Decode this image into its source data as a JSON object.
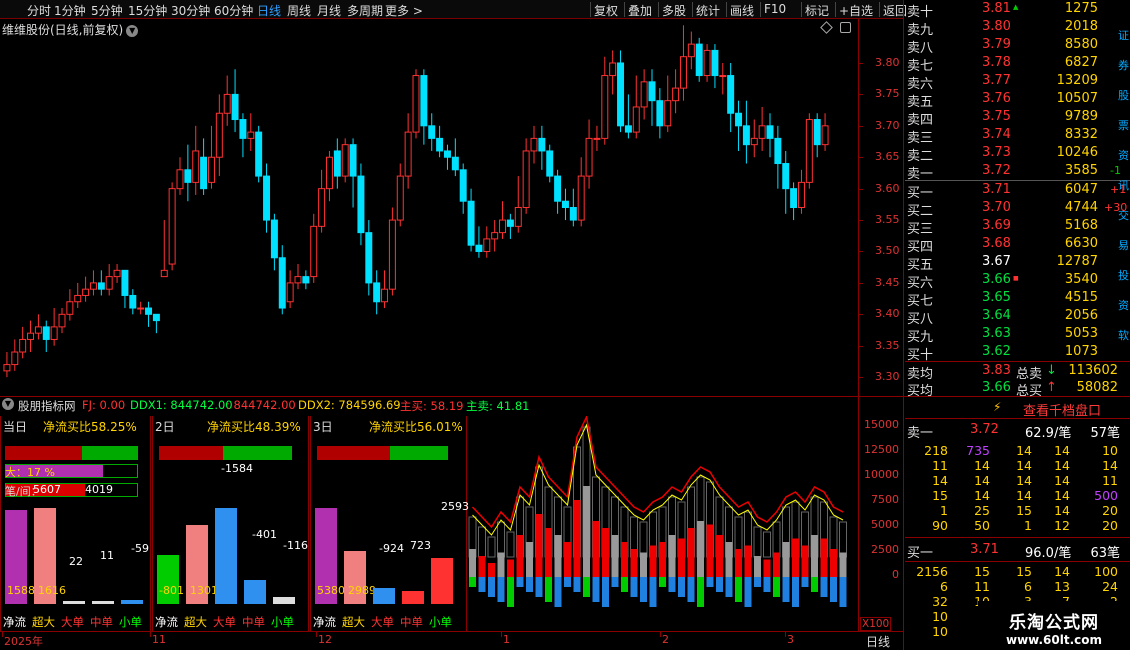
{
  "toolbar": {
    "periods": [
      "分时",
      "1分钟",
      "5分钟",
      "15分钟",
      "30分钟",
      "60分钟",
      "日线",
      "周线",
      "月线",
      "多周期",
      "更多 >"
    ],
    "active": "日线",
    "right": [
      "复权",
      "叠加",
      "多股",
      "统计",
      "画线",
      "F10",
      "标记",
      "+自选",
      "返回"
    ]
  },
  "chart": {
    "title": "维维股份(日线,前复权)",
    "price_ticks": [
      "3.80",
      "3.75",
      "3.70",
      "3.65",
      "3.60",
      "3.55",
      "3.50",
      "3.45",
      "3.40",
      "3.35",
      "3.30"
    ],
    "colors": {
      "up": "#ff3232",
      "down": "#00e0ff",
      "bg": "#000000"
    }
  },
  "chart_data": {
    "type": "candlestick",
    "ylim": [
      3.27,
      3.87
    ],
    "candles": [
      [
        3.31,
        3.32,
        3.3,
        3.34
      ],
      [
        3.32,
        3.34,
        3.31,
        3.36
      ],
      [
        3.34,
        3.36,
        3.33,
        3.38
      ],
      [
        3.36,
        3.37,
        3.34,
        3.39
      ],
      [
        3.37,
        3.38,
        3.36,
        3.4
      ],
      [
        3.38,
        3.36,
        3.34,
        3.39
      ],
      [
        3.36,
        3.38,
        3.35,
        3.41
      ],
      [
        3.38,
        3.4,
        3.37,
        3.41
      ],
      [
        3.4,
        3.42,
        3.39,
        3.44
      ],
      [
        3.42,
        3.43,
        3.41,
        3.45
      ],
      [
        3.43,
        3.44,
        3.42,
        3.46
      ],
      [
        3.44,
        3.45,
        3.43,
        3.47
      ],
      [
        3.45,
        3.44,
        3.43,
        3.47
      ],
      [
        3.44,
        3.46,
        3.43,
        3.48
      ],
      [
        3.46,
        3.47,
        3.45,
        3.48
      ],
      [
        3.47,
        3.43,
        3.41,
        3.47
      ],
      [
        3.43,
        3.41,
        3.4,
        3.44
      ],
      [
        3.41,
        3.41,
        3.4,
        3.42
      ],
      [
        3.41,
        3.4,
        3.38,
        3.42
      ],
      [
        3.4,
        3.39,
        3.37,
        3.4
      ],
      [
        3.46,
        3.47,
        3.46,
        3.55
      ],
      [
        3.48,
        3.6,
        3.47,
        3.61
      ],
      [
        3.6,
        3.63,
        3.59,
        3.65
      ],
      [
        3.63,
        3.61,
        3.58,
        3.67
      ],
      [
        3.61,
        3.66,
        3.59,
        3.7
      ],
      [
        3.65,
        3.6,
        3.59,
        3.68
      ],
      [
        3.61,
        3.65,
        3.6,
        3.7
      ],
      [
        3.65,
        3.72,
        3.62,
        3.75
      ],
      [
        3.72,
        3.75,
        3.7,
        3.78
      ],
      [
        3.75,
        3.71,
        3.69,
        3.79
      ],
      [
        3.71,
        3.68,
        3.65,
        3.72
      ],
      [
        3.68,
        3.69,
        3.66,
        3.72
      ],
      [
        3.69,
        3.62,
        3.61,
        3.7
      ],
      [
        3.62,
        3.55,
        3.53,
        3.64
      ],
      [
        3.55,
        3.49,
        3.47,
        3.56
      ],
      [
        3.49,
        3.41,
        3.4,
        3.51
      ],
      [
        3.42,
        3.45,
        3.41,
        3.47
      ],
      [
        3.45,
        3.46,
        3.44,
        3.48
      ],
      [
        3.46,
        3.45,
        3.44,
        3.47
      ],
      [
        3.46,
        3.54,
        3.45,
        3.56
      ],
      [
        3.54,
        3.6,
        3.53,
        3.63
      ],
      [
        3.6,
        3.65,
        3.58,
        3.66
      ],
      [
        3.66,
        3.62,
        3.6,
        3.68
      ],
      [
        3.62,
        3.67,
        3.61,
        3.68
      ],
      [
        3.67,
        3.62,
        3.57,
        3.68
      ],
      [
        3.62,
        3.53,
        3.51,
        3.64
      ],
      [
        3.53,
        3.45,
        3.43,
        3.55
      ],
      [
        3.45,
        3.42,
        3.4,
        3.47
      ],
      [
        3.42,
        3.44,
        3.41,
        3.47
      ],
      [
        3.44,
        3.55,
        3.43,
        3.57
      ],
      [
        3.55,
        3.62,
        3.54,
        3.64
      ],
      [
        3.62,
        3.69,
        3.6,
        3.72
      ],
      [
        3.69,
        3.78,
        3.68,
        3.79
      ],
      [
        3.78,
        3.7,
        3.67,
        3.79
      ],
      [
        3.7,
        3.68,
        3.66,
        3.72
      ],
      [
        3.68,
        3.66,
        3.65,
        3.7
      ],
      [
        3.66,
        3.65,
        3.63,
        3.67
      ],
      [
        3.65,
        3.63,
        3.62,
        3.68
      ],
      [
        3.63,
        3.58,
        3.56,
        3.64
      ],
      [
        3.58,
        3.51,
        3.5,
        3.6
      ],
      [
        3.51,
        3.5,
        3.49,
        3.54
      ],
      [
        3.5,
        3.52,
        3.49,
        3.54
      ],
      [
        3.52,
        3.53,
        3.5,
        3.55
      ],
      [
        3.53,
        3.55,
        3.52,
        3.58
      ],
      [
        3.55,
        3.54,
        3.52,
        3.56
      ],
      [
        3.54,
        3.57,
        3.53,
        3.62
      ],
      [
        3.57,
        3.66,
        3.56,
        3.68
      ],
      [
        3.66,
        3.68,
        3.64,
        3.7
      ],
      [
        3.68,
        3.66,
        3.63,
        3.7
      ],
      [
        3.66,
        3.62,
        3.61,
        3.67
      ],
      [
        3.62,
        3.58,
        3.56,
        3.63
      ],
      [
        3.58,
        3.57,
        3.55,
        3.6
      ],
      [
        3.57,
        3.55,
        3.54,
        3.6
      ],
      [
        3.55,
        3.62,
        3.54,
        3.65
      ],
      [
        3.62,
        3.68,
        3.6,
        3.71
      ],
      [
        3.68,
        3.68,
        3.66,
        3.7
      ],
      [
        3.68,
        3.78,
        3.67,
        3.81
      ],
      [
        3.78,
        3.8,
        3.75,
        3.82
      ],
      [
        3.8,
        3.7,
        3.69,
        3.82
      ],
      [
        3.7,
        3.69,
        3.68,
        3.75
      ],
      [
        3.69,
        3.73,
        3.68,
        3.78
      ],
      [
        3.73,
        3.77,
        3.71,
        3.79
      ],
      [
        3.77,
        3.74,
        3.7,
        3.79
      ],
      [
        3.74,
        3.7,
        3.68,
        3.76
      ],
      [
        3.7,
        3.74,
        3.69,
        3.78
      ],
      [
        3.74,
        3.76,
        3.72,
        3.79
      ],
      [
        3.76,
        3.81,
        3.74,
        3.86
      ],
      [
        3.81,
        3.83,
        3.79,
        3.85
      ],
      [
        3.83,
        3.78,
        3.77,
        3.84
      ],
      [
        3.78,
        3.82,
        3.77,
        3.83
      ],
      [
        3.82,
        3.78,
        3.76,
        3.83
      ],
      [
        3.78,
        3.78,
        3.75,
        3.8
      ],
      [
        3.78,
        3.72,
        3.69,
        3.8
      ],
      [
        3.72,
        3.7,
        3.66,
        3.74
      ],
      [
        3.7,
        3.67,
        3.64,
        3.74
      ],
      [
        3.67,
        3.68,
        3.65,
        3.71
      ],
      [
        3.68,
        3.7,
        3.66,
        3.73
      ],
      [
        3.7,
        3.68,
        3.65,
        3.72
      ],
      [
        3.68,
        3.64,
        3.6,
        3.7
      ],
      [
        3.64,
        3.6,
        3.56,
        3.66
      ],
      [
        3.6,
        3.57,
        3.55,
        3.61
      ],
      [
        3.57,
        3.61,
        3.56,
        3.63
      ],
      [
        3.61,
        3.71,
        3.6,
        3.72
      ],
      [
        3.71,
        3.67,
        3.65,
        3.72
      ],
      [
        3.67,
        3.7,
        3.66,
        3.72
      ]
    ]
  },
  "indicator_bar": {
    "name": "股朋指标网",
    "items": [
      {
        "t": "FJ: 0.00",
        "c": "#ff3232"
      },
      {
        "t": "DDX1: 844742.00",
        "c": "#00ff40"
      },
      {
        "t": ": 844742.00",
        "c": "#ff3232"
      },
      {
        "t": "DDX2: 784596.69",
        "c": "#ffd400"
      },
      {
        "t": "主买: 58.19",
        "c": "#ff3232"
      },
      {
        "t": "主卖: 41.81",
        "c": "#00ff40"
      }
    ]
  },
  "panel1": {
    "title": "当日",
    "ratio": "净流买比58.25%",
    "label1": "大：17 %",
    "label2": "笔/间：",
    "n1": "5607",
    "n2": "4019",
    "bars": [
      "1588",
      "1616",
      "22",
      "11",
      "-59"
    ]
  },
  "panel2": {
    "title": "2日",
    "ratio": "净流买比48.39%",
    "bars": [
      "-801",
      "1301",
      "-1584",
      "-401",
      "-116"
    ]
  },
  "panel3": {
    "title": "3日",
    "ratio": "净流买比56.01%",
    "bars": [
      "5380",
      "2989",
      "-924",
      "723",
      "2593"
    ]
  },
  "captions": [
    "净流",
    "超大",
    "大单",
    "中单",
    "小单"
  ],
  "ind_axis": [
    "15000",
    "12500",
    "10000",
    "7500",
    "5000",
    "2500",
    "0"
  ],
  "x100": "X100",
  "bottom": {
    "months": [
      "2025年",
      "11",
      "12",
      "1",
      "2",
      "3"
    ],
    "freq": "日线"
  },
  "quote": {
    "asks": [
      [
        "卖十",
        "3.81",
        "1275"
      ],
      [
        "卖九",
        "3.80",
        "2018"
      ],
      [
        "卖八",
        "3.79",
        "8580"
      ],
      [
        "卖七",
        "3.78",
        "6827"
      ],
      [
        "卖六",
        "3.77",
        "13209"
      ],
      [
        "卖五",
        "3.76",
        "10507"
      ],
      [
        "卖四",
        "3.75",
        "9789"
      ],
      [
        "卖三",
        "3.74",
        "8332"
      ],
      [
        "卖二",
        "3.73",
        "10246"
      ],
      [
        "卖一",
        "3.72",
        "3585"
      ]
    ],
    "bids": [
      [
        "买一",
        "3.71",
        "6047"
      ],
      [
        "买二",
        "3.70",
        "4744"
      ],
      [
        "买三",
        "3.69",
        "5168"
      ],
      [
        "买四",
        "3.68",
        "6630"
      ],
      [
        "买五",
        "3.67",
        "12787"
      ],
      [
        "买六",
        "3.66",
        "3540"
      ],
      [
        "买七",
        "3.65",
        "4515"
      ],
      [
        "买八",
        "3.64",
        "2056"
      ],
      [
        "买九",
        "3.63",
        "5053"
      ],
      [
        "买十",
        "3.62",
        "1073"
      ]
    ],
    "ask_marks": [
      "-1"
    ],
    "bid_marks": [
      "+1",
      "+30"
    ],
    "ask_avg": [
      "卖均",
      "3.83",
      "总卖",
      "113602"
    ],
    "bid_avg": [
      "买均",
      "3.66",
      "总买",
      "58082"
    ]
  },
  "tick": {
    "button": "查看千档盘口",
    "ask1": [
      "卖一",
      "3.72",
      "62.9/笔",
      "57笔"
    ],
    "ask_rows": [
      [
        "218",
        "735",
        "14",
        "14",
        "10"
      ],
      [
        "11",
        "14",
        "14",
        "14",
        "14"
      ],
      [
        "14",
        "14",
        "14",
        "14",
        "11"
      ],
      [
        "15",
        "14",
        "14",
        "14",
        "500"
      ],
      [
        "1",
        "25",
        "15",
        "14",
        "20"
      ],
      [
        "90",
        "50",
        "1",
        "12",
        "20"
      ]
    ],
    "bid1": [
      "买一",
      "3.71",
      "96.0/笔",
      "63笔"
    ],
    "bid_rows": [
      [
        "2156",
        "15",
        "15",
        "14",
        "100"
      ],
      [
        "6",
        "11",
        "6",
        "13",
        "24"
      ],
      [
        "32",
        "10",
        "3",
        "7",
        "2"
      ],
      [
        "10",
        "",
        "",
        "",
        ""
      ],
      [
        "10",
        "",
        "",
        "",
        ""
      ]
    ]
  },
  "side_chars": [
    "证",
    "券",
    "股",
    "票",
    "资",
    "讯",
    "交",
    "易",
    "投",
    "资",
    "软"
  ],
  "watermark": {
    "title": "乐淘公式网",
    "url": "www.60lt.com"
  }
}
